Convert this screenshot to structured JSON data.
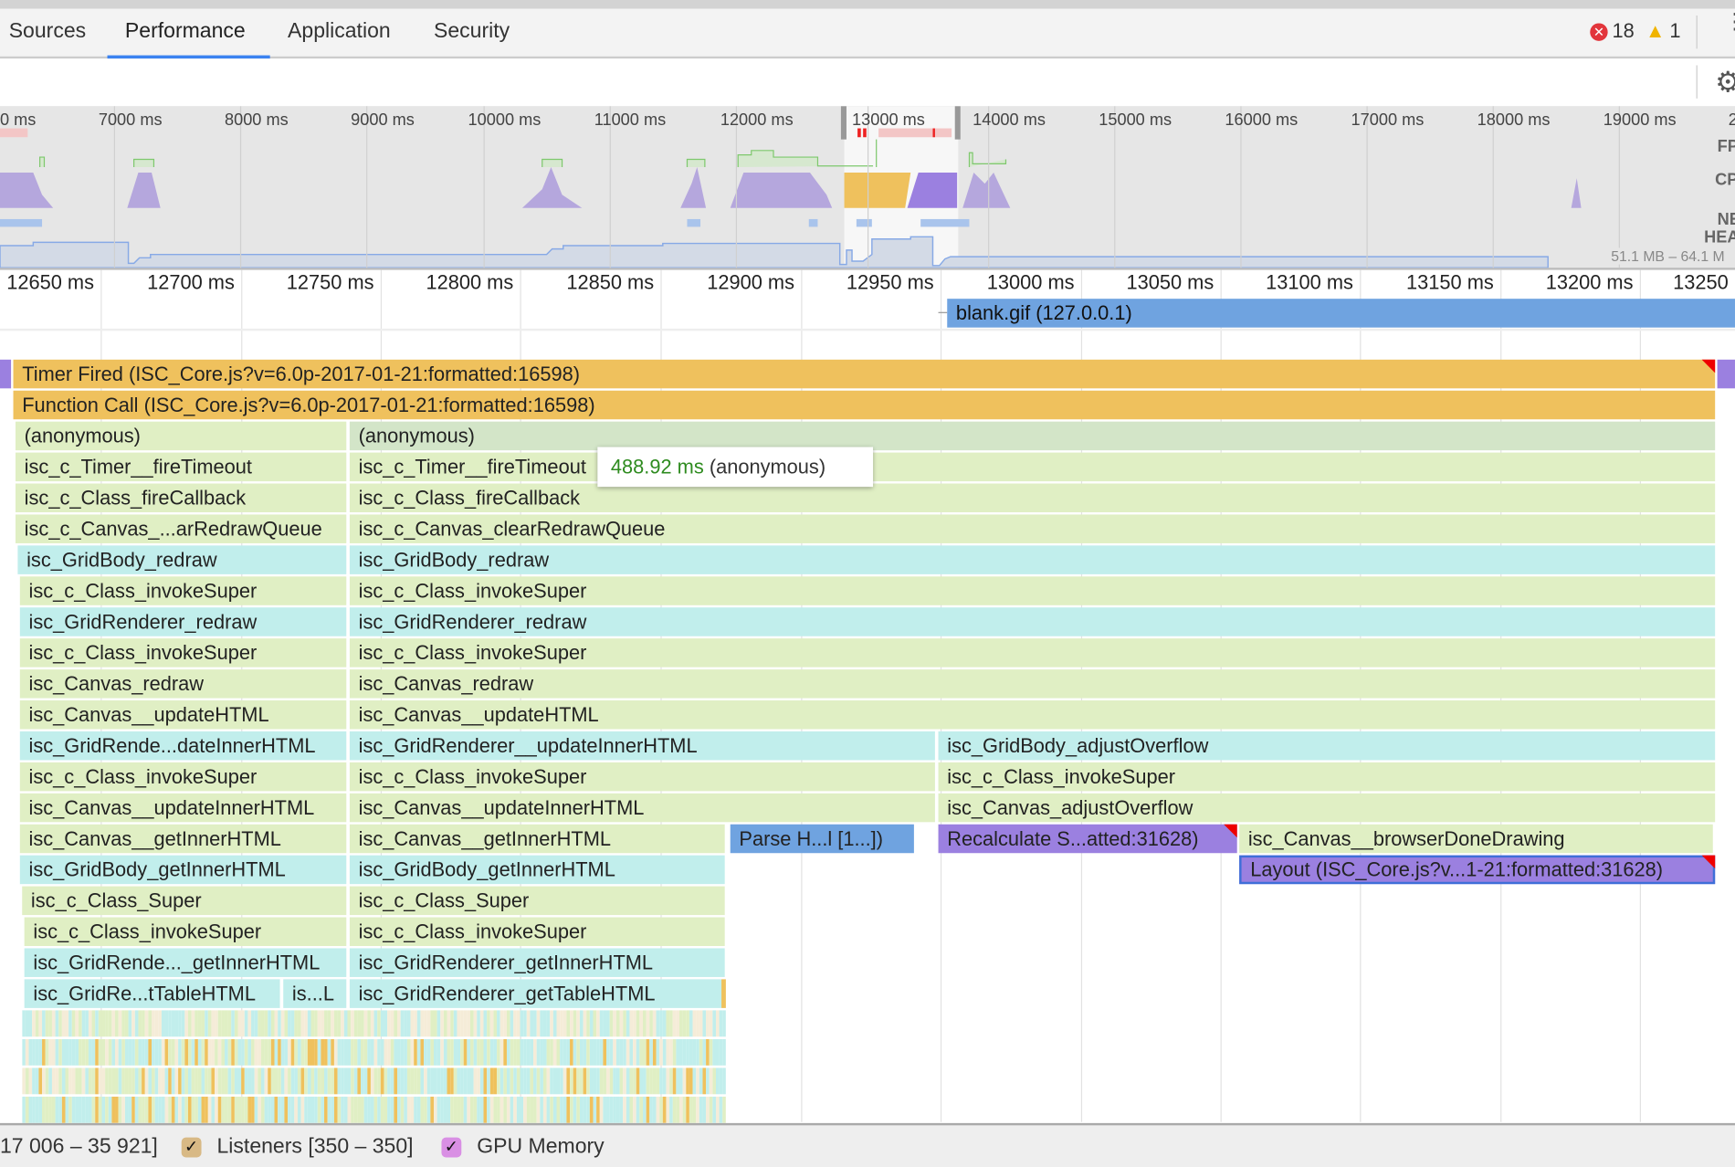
{
  "tabs": [
    {
      "label": "Sources",
      "active": false
    },
    {
      "label": "Performance",
      "active": true
    },
    {
      "label": "Application",
      "active": false
    },
    {
      "label": "Security",
      "active": false
    }
  ],
  "status": {
    "errors": "18",
    "warnings": "1",
    "error_icon": "error-circle-icon",
    "warning_icon": "warning-triangle-icon"
  },
  "toolbar": {
    "settings_icon": "gear-icon"
  },
  "overview": {
    "ticks": [
      "0 ms",
      "7000 ms",
      "8000 ms",
      "9000 ms",
      "10000 ms",
      "11000 ms",
      "12000 ms",
      "13000 ms",
      "14000 ms",
      "15000 ms",
      "16000 ms",
      "17000 ms",
      "18000 ms",
      "19000 ms",
      "2"
    ],
    "track_labels": [
      "FP",
      "CP",
      "NE",
      "HEA"
    ],
    "heap_range": "51.1 MB – 64.1 M"
  },
  "ruler": {
    "ticks": [
      "12650 ms",
      "12700 ms",
      "12750 ms",
      "12800 ms",
      "12850 ms",
      "12900 ms",
      "12950 ms",
      "13000 ms",
      "13050 ms",
      "13100 ms",
      "13150 ms",
      "13200 ms",
      "13250"
    ]
  },
  "network": {
    "request": "blank.gif (127.0.0.1)"
  },
  "flame": {
    "rows": [
      [
        "",
        "Timer Fired (ISC_Core.js?v=6.0p-2017-01-21:formatted:16598)",
        ""
      ],
      [
        "Function Call (ISC_Core.js?v=6.0p-2017-01-21:formatted:16598)"
      ],
      [
        "(anonymous)",
        "(anonymous)"
      ],
      [
        "isc_c_Timer__fireTimeout",
        "isc_c_Timer__fireTimeout"
      ],
      [
        "isc_c_Class_fireCallback",
        "isc_c_Class_fireCallback"
      ],
      [
        "isc_c_Canvas_...arRedrawQueue",
        "isc_c_Canvas_clearRedrawQueue"
      ],
      [
        "isc_GridBody_redraw",
        "isc_GridBody_redraw"
      ],
      [
        "isc_c_Class_invokeSuper",
        "isc_c_Class_invokeSuper"
      ],
      [
        "isc_GridRenderer_redraw",
        "isc_GridRenderer_redraw"
      ],
      [
        "isc_c_Class_invokeSuper",
        "isc_c_Class_invokeSuper"
      ],
      [
        "isc_Canvas_redraw",
        "isc_Canvas_redraw"
      ],
      [
        "isc_Canvas__updateHTML",
        "isc_Canvas__updateHTML"
      ],
      [
        "isc_GridRende...dateInnerHTML",
        "isc_GridRenderer__updateInnerHTML",
        "isc_GridBody_adjustOverflow"
      ],
      [
        "isc_c_Class_invokeSuper",
        "isc_c_Class_invokeSuper",
        "isc_c_Class_invokeSuper"
      ],
      [
        "isc_Canvas__updateInnerHTML",
        "isc_Canvas__updateInnerHTML",
        "isc_Canvas_adjustOverflow"
      ],
      [
        "isc_Canvas__getInnerHTML",
        "isc_Canvas__getInnerHTML",
        "Parse H...l [1...])",
        "Recalculate S...atted:31628)",
        "isc_Canvas__browserDoneDrawing"
      ],
      [
        "isc_GridBody_getInnerHTML",
        "isc_GridBody_getInnerHTML",
        "Layout (ISC_Core.js?v...1-21:formatted:31628)"
      ],
      [
        "isc_c_Class_Super",
        "isc_c_Class_Super"
      ],
      [
        "isc_c_Class_invokeSuper",
        "isc_c_Class_invokeSuper"
      ],
      [
        "isc_GridRende..._getInnerHTML",
        "isc_GridRenderer_getInnerHTML"
      ],
      [
        "isc_GridRe...tTableHTML",
        "is...L",
        "isc_GridRenderer_getTableHTML",
        ""
      ]
    ]
  },
  "tooltip": {
    "duration": "488.92 ms",
    "name": "(anonymous)"
  },
  "bottom": {
    "range_text": "17 006 – 35 921]",
    "listeners_label": "Listeners [350 – 350]",
    "listeners_checked": true,
    "gpu_label": "GPU Memory",
    "gpu_checked": true,
    "check_glyph": "✓"
  },
  "colors": {
    "scripting": "#efc15d",
    "js_green": "#e0efc4",
    "js_green_dark": "#d3e5c8",
    "js_cyan": "#c1eeec",
    "rendering": "#9b80e0",
    "loading": "#6fa3e0",
    "accent": "#3b82f0",
    "duration_green": "#2e8b1f"
  }
}
